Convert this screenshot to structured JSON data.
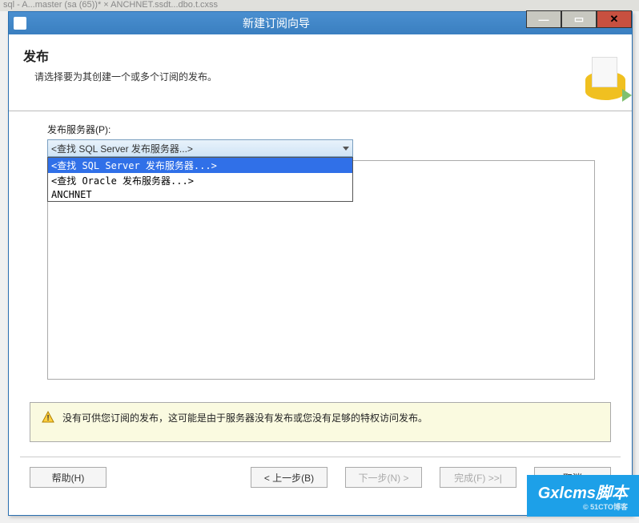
{
  "bg_tabs_text": "sql - A...master (sa (65))* × ANCHNET.ssdt...dbo.t.cxss",
  "window": {
    "title": "新建订阅向导"
  },
  "header": {
    "title": "发布",
    "subtitle": "请选择要为其创建一个或多个订阅的发布。"
  },
  "publisher": {
    "label": "发布服务器(P):",
    "selected": "<查找 SQL Server 发布服务器...>",
    "options": [
      "<查找 SQL Server 发布服务器...>",
      "<查找 Oracle 发布服务器...>",
      "ANCHNET"
    ]
  },
  "warning": "没有可供您订阅的发布，这可能是由于服务器没有发布或您没有足够的特权访问发布。",
  "buttons": {
    "help": "帮助(H)",
    "back": "< 上一步(B)",
    "next": "下一步(N) >",
    "finish": "完成(F) >>|",
    "cancel": "取消"
  },
  "watermark": {
    "main": "Gxlcms脚本",
    "sub": "© 51CTO博客"
  }
}
